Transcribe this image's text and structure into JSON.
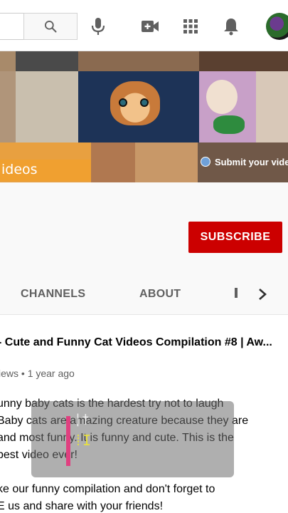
{
  "topbar": {
    "icons": {
      "search": "search-icon",
      "mic": "microphone-icon",
      "create": "video-camera-plus-icon",
      "apps": "apps-grid-icon",
      "notifications": "bell-icon",
      "avatar": "user-avatar"
    }
  },
  "banner": {
    "videos_text": "ideos",
    "submit_text": "Submit your vide"
  },
  "header": {
    "subscribe_label": "SUBSCRIBE"
  },
  "tabs": {
    "items": [
      "CHANNELS",
      "ABOUT"
    ],
    "next_icon": "chevron-right-icon"
  },
  "video": {
    "title": "- Cute and Funny Cat Videos Compilation #8 | Aw...",
    "meta": "iews • 1 year ago",
    "description": [
      "unny baby cats is the hardest try not to laugh",
      "Baby cats are amazing creature because they are",
      "and most funny. It is funny and cute. This is the",
      "best video ever!",
      "",
      "ke our funny compilation and don't forget to",
      "E us and share with your friends!"
    ]
  },
  "colors": {
    "subscribe_bg": "#cc0000",
    "overlay_bar": "#e04080",
    "tab_text": "#606060"
  }
}
